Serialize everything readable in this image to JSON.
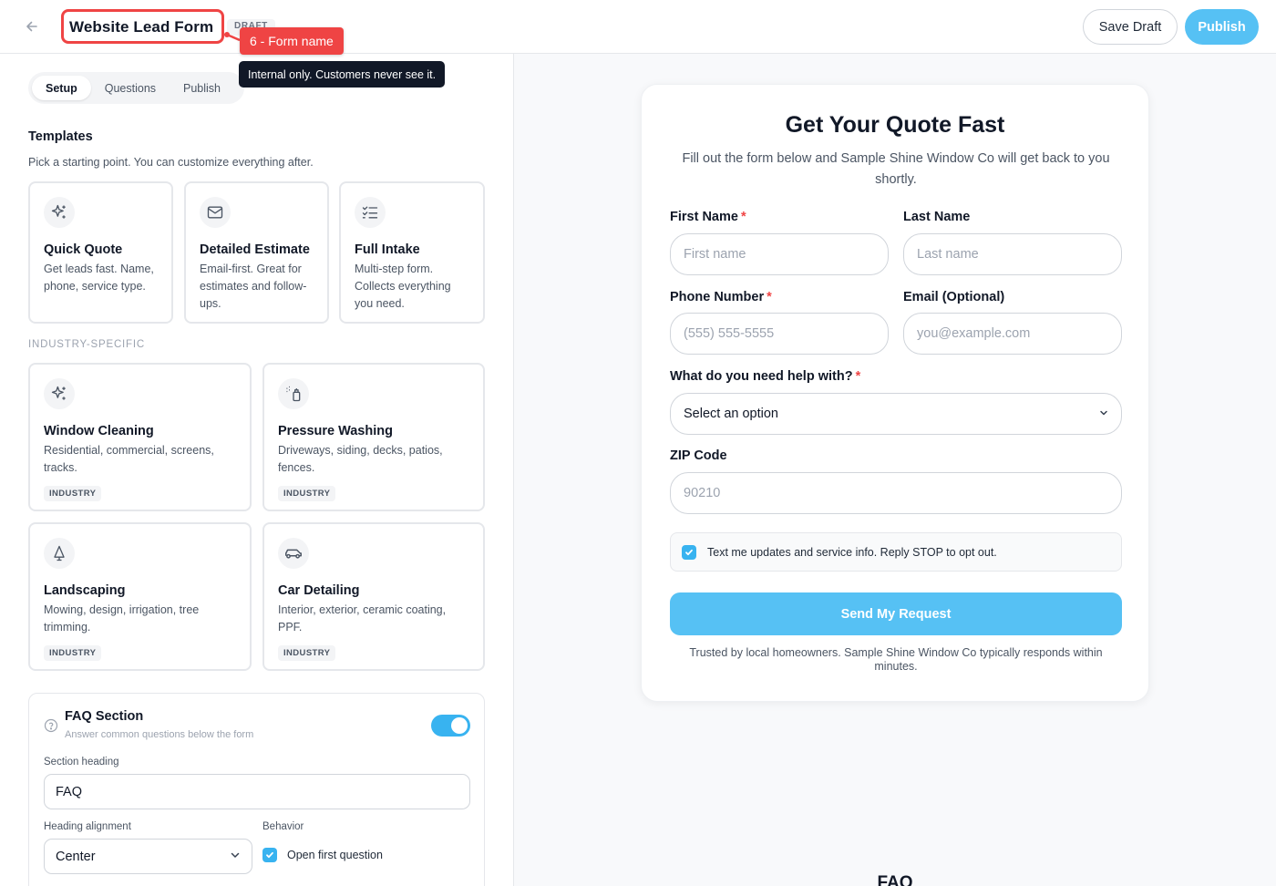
{
  "header": {
    "form_name": "Website Lead Form",
    "status_badge": "DRAFT",
    "annotation_label": "6 - Form name",
    "tooltip": "Internal only. Customers never see it.",
    "save_draft": "Save Draft",
    "publish": "Publish"
  },
  "tabs": [
    {
      "label": "Setup",
      "active": true
    },
    {
      "label": "Questions",
      "active": false
    },
    {
      "label": "Publish",
      "active": false
    }
  ],
  "templates": {
    "heading": "Templates",
    "subheading": "Pick a starting point. You can customize everything after.",
    "general": [
      {
        "icon": "sparkles-icon",
        "title": "Quick Quote",
        "description": "Get leads fast. Name, phone, service type."
      },
      {
        "icon": "envelope-icon",
        "title": "Detailed Estimate",
        "description": "Email-first. Great for estimates and follow-ups."
      },
      {
        "icon": "checklist-icon",
        "title": "Full Intake",
        "description": "Multi-step form. Collects everything you need."
      }
    ],
    "industry_heading": "INDUSTRY-SPECIFIC",
    "industry": [
      {
        "icon": "sparkles-icon",
        "title": "Window Cleaning",
        "description": "Residential, commercial, screens, tracks.",
        "badge": "INDUSTRY"
      },
      {
        "icon": "spray-bottle-icon",
        "title": "Pressure Washing",
        "description": "Driveways, siding, decks, patios, fences.",
        "badge": "INDUSTRY"
      },
      {
        "icon": "plant-icon",
        "title": "Landscaping",
        "description": "Mowing, design, irrigation, tree trimming.",
        "badge": "INDUSTRY"
      },
      {
        "icon": "car-icon",
        "title": "Car Detailing",
        "description": "Interior, exterior, ceramic coating, PPF.",
        "badge": "INDUSTRY"
      }
    ]
  },
  "faq_settings": {
    "title": "FAQ Section",
    "subtitle": "Answer common questions below the form",
    "enabled": true,
    "heading_label": "Section heading",
    "heading_value": "FAQ",
    "alignment_label": "Heading alignment",
    "alignment_value": "Center",
    "behavior_label": "Behavior",
    "open_first_label": "Open first question",
    "open_first_checked": true
  },
  "preview": {
    "title": "Get Your Quote Fast",
    "subtitle": "Fill out the form below and Sample Shine Window Co will get back to you shortly.",
    "first_name_label": "First Name",
    "first_name_placeholder": "First name",
    "last_name_label": "Last Name",
    "last_name_placeholder": "Last name",
    "phone_label": "Phone Number",
    "phone_placeholder": "(555) 555-5555",
    "email_label": "Email (Optional)",
    "email_placeholder": "you@example.com",
    "help_label": "What do you need help with?",
    "help_select": "Select an option",
    "zip_label": "ZIP Code",
    "zip_placeholder": "90210",
    "required_mark": "*",
    "sms_consent": "Text me updates and service info. Reply STOP to opt out.",
    "sms_checked": true,
    "submit": "Send My Request",
    "trust_text": "Trusted by local homeowners. Sample Shine Window Co typically responds within minutes.",
    "faq_heading": "FAQ"
  },
  "colors": {
    "accent": "#56c1f4",
    "toggle_on": "#38b3f0",
    "annotation_red": "#ef4444",
    "tooltip_bg": "#111827"
  }
}
